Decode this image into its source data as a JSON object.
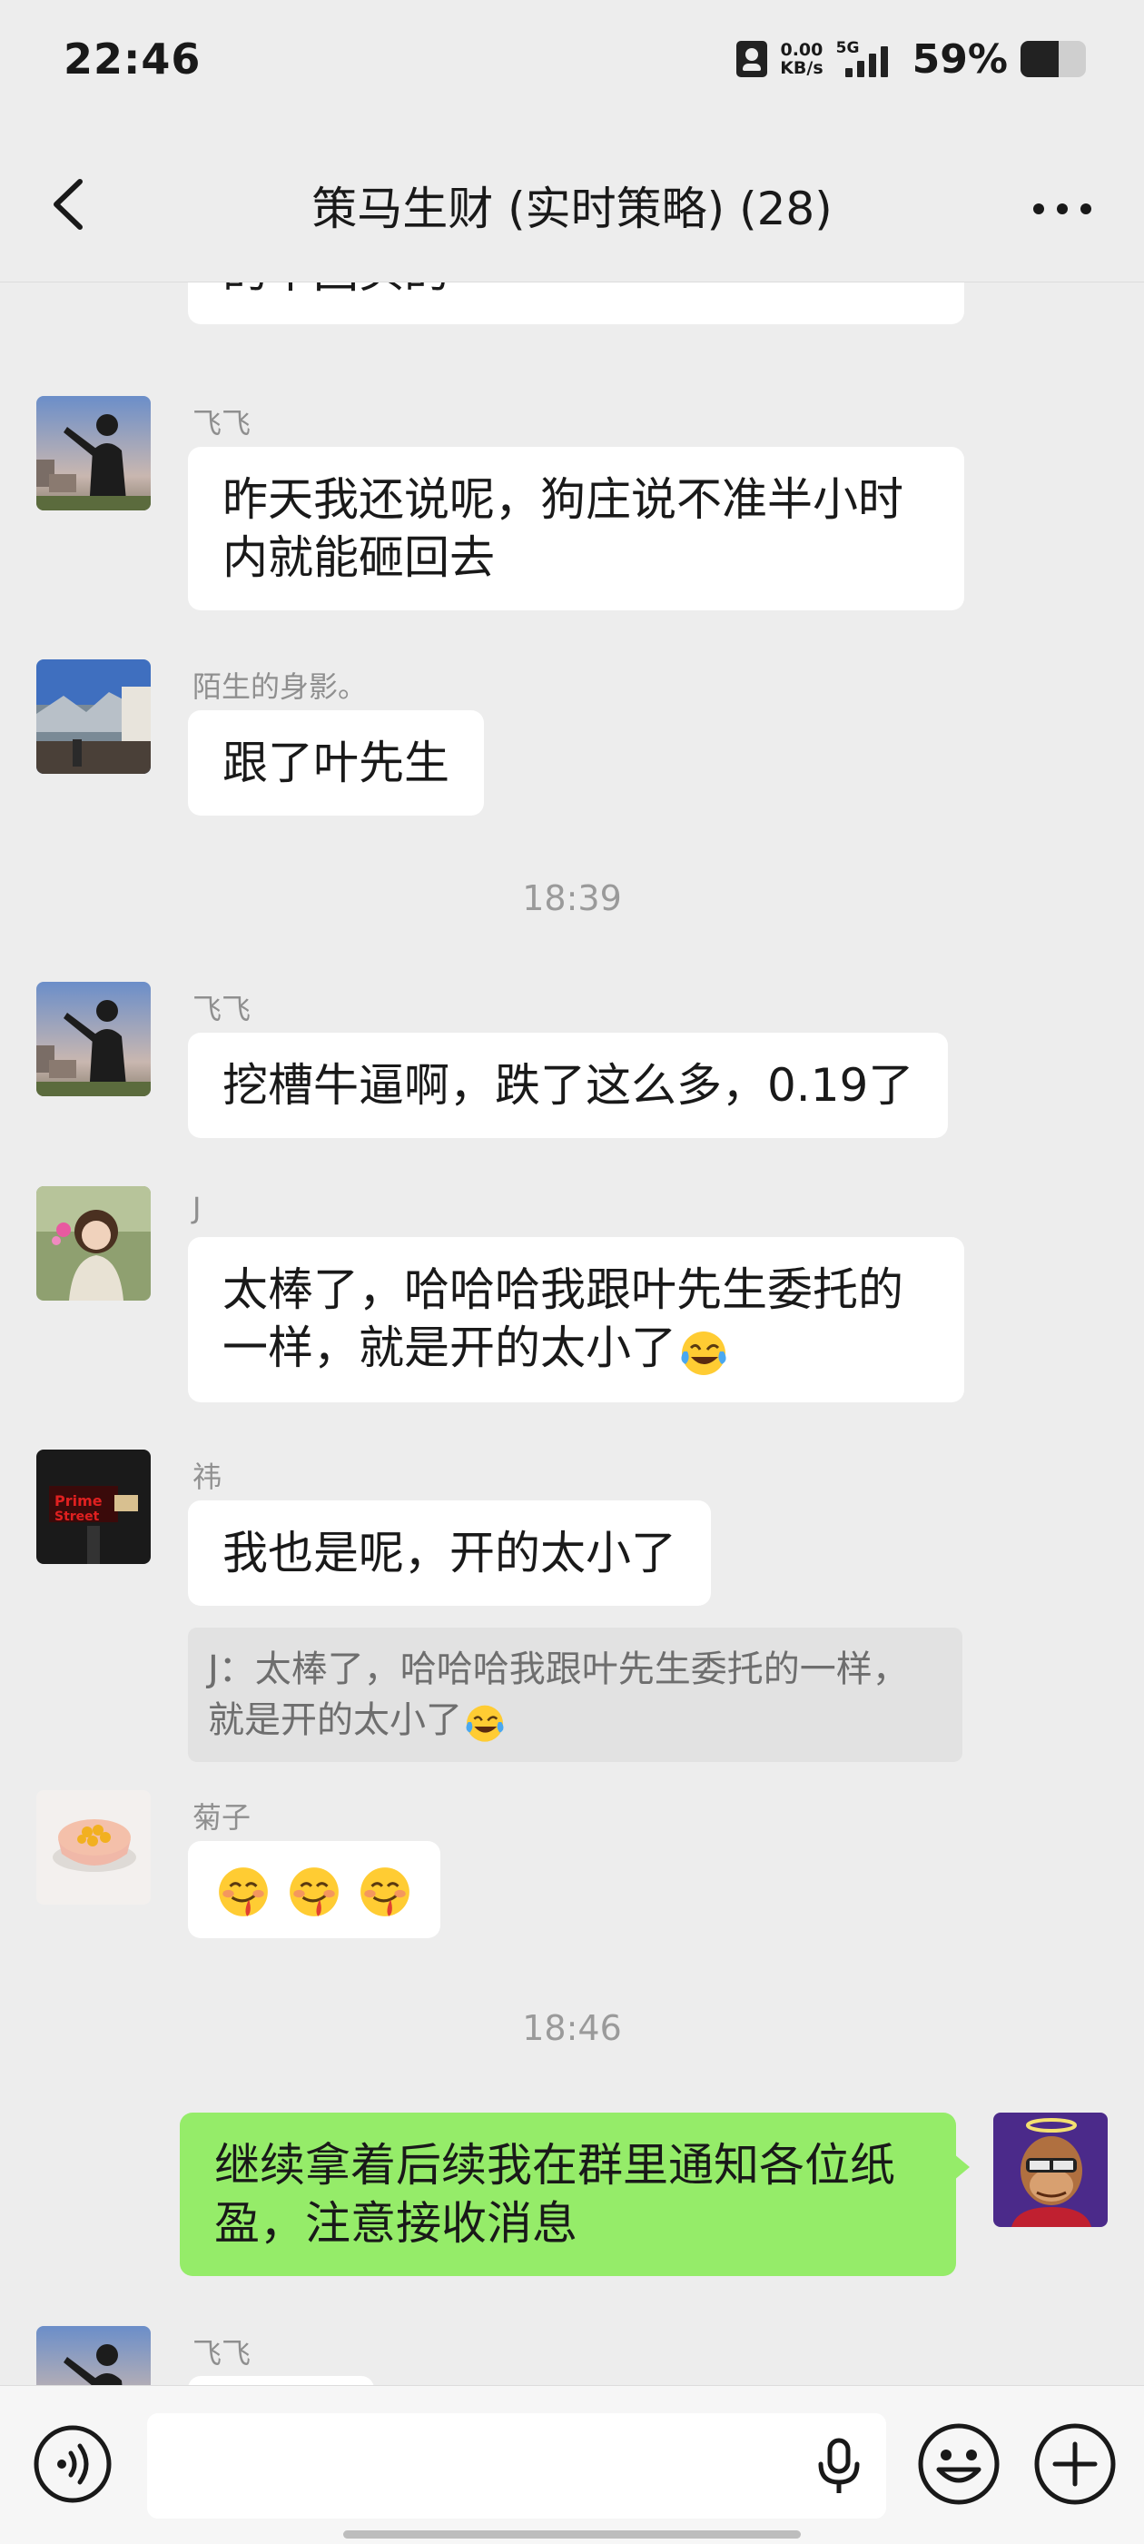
{
  "status_bar": {
    "time": "22:46",
    "net_speed_value": "0.00",
    "net_speed_unit": "KB/s",
    "network": "5G",
    "battery_percent": "59%",
    "battery_level": 0.59
  },
  "header": {
    "title": "策马生财 (实时策略) (28)",
    "back_icon": "chevron-left-icon",
    "more_icon": "more-horizontal-icon"
  },
  "messages": [
    {
      "text": "的不回头的"
    },
    {
      "sender": "飞飞",
      "text": "昨天我还说呢，狗庄说不准半小时内就能砸回去"
    },
    {
      "sender": "陌生的身影。",
      "text": "跟了叶先生"
    },
    {
      "timestamp": "18:39"
    },
    {
      "sender": "飞飞",
      "text": "挖槽牛逼啊，跌了这么多，0.19了"
    },
    {
      "sender": "J",
      "text": "太棒了，哈哈哈我跟叶先生委托的一样，就是开的太小了"
    },
    {
      "sender": "祎",
      "text": "我也是呢，开的太小了"
    },
    {
      "quote": "J：太棒了，哈哈哈我跟叶先生委托的一样，就是开的太小了"
    },
    {
      "sender": "菊子",
      "emojis": [
        "drooling-face-emoji",
        "drooling-face-emoji",
        "drooling-face-emoji"
      ]
    },
    {
      "timestamp": "18:46"
    },
    {
      "self": true,
      "text": "继续拿着后续我在群里通知各位纸盈，注意接收消息"
    },
    {
      "sender": "飞飞"
    }
  ],
  "input_bar": {
    "voice_icon": "voice-mode-icon",
    "mic_icon": "microphone-icon",
    "emoji_icon": "emoji-smile-icon",
    "plus_icon": "plus-circle-icon",
    "placeholder": ""
  },
  "colors": {
    "background": "#ededed",
    "self_bubble": "#95ec69",
    "other_bubble": "#ffffff",
    "sender_name": "#8f8f8f"
  }
}
